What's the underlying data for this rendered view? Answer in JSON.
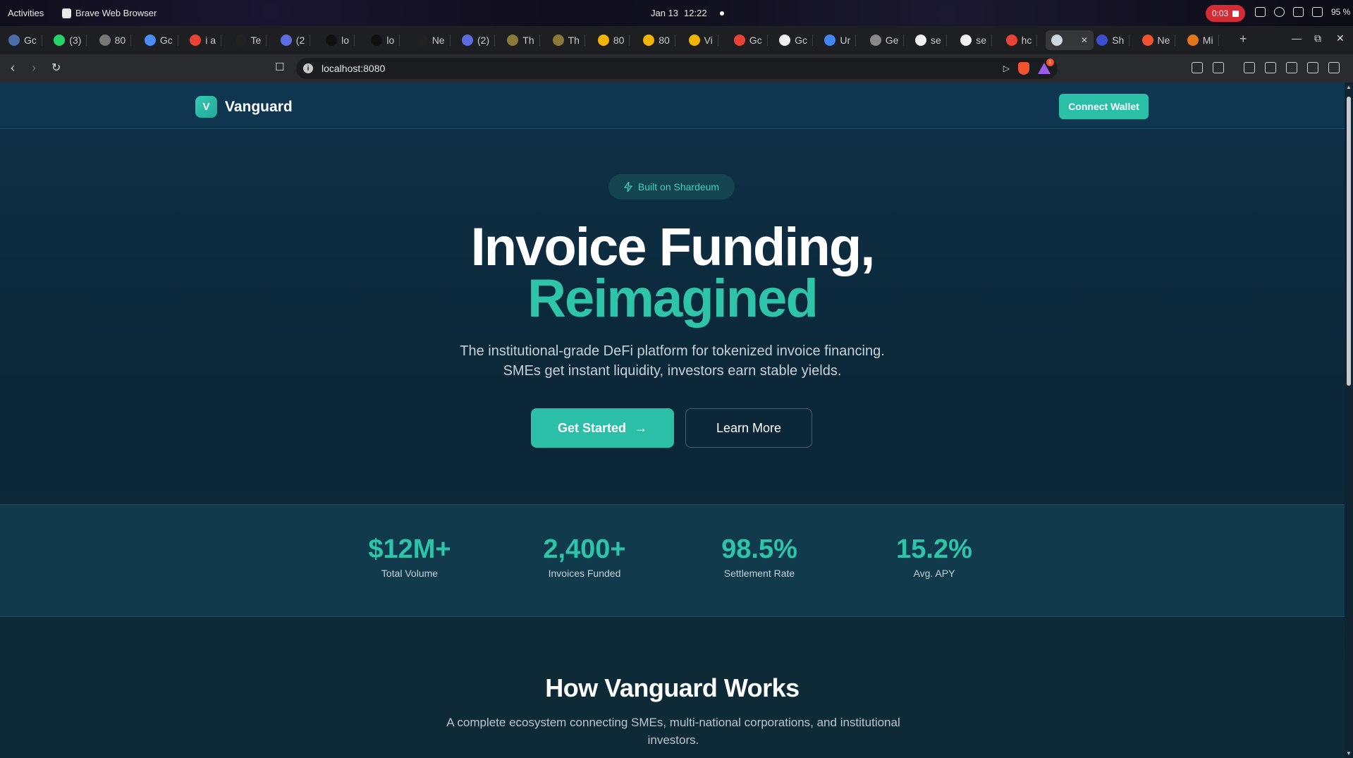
{
  "os_bar": {
    "activities": "Activities",
    "app_name": "Brave Web Browser",
    "date": "Jan 13",
    "time": "12:22",
    "recording_time": "0:03",
    "battery": "95 %"
  },
  "browser": {
    "tabs": [
      {
        "label": "Gc",
        "icon": "globe-icon",
        "color": "#4a6da7"
      },
      {
        "label": "(3)",
        "icon": "whatsapp-icon",
        "color": "#25d366"
      },
      {
        "label": "80",
        "icon": "globe-icon",
        "color": "#777"
      },
      {
        "label": "Gc",
        "icon": "gemini-icon",
        "color": "#4b8df8"
      },
      {
        "label": "i a",
        "icon": "google-icon",
        "color": "#ea4335"
      },
      {
        "label": "Te",
        "icon": "triangle-icon",
        "color": "#222"
      },
      {
        "label": "(2",
        "icon": "chrome-icon",
        "color": "#5b6ee1"
      },
      {
        "label": "lo",
        "icon": "vercel-icon",
        "color": "#111"
      },
      {
        "label": "lo",
        "icon": "vercel-icon",
        "color": "#111"
      },
      {
        "label": "Ne",
        "icon": "triangle-icon",
        "color": "#222"
      },
      {
        "label": "(2)",
        "icon": "chrome-icon",
        "color": "#5b6ee1"
      },
      {
        "label": "Th",
        "icon": "coin-icon",
        "color": "#8a7a3a"
      },
      {
        "label": "Th",
        "icon": "coin-icon",
        "color": "#8a7a3a"
      },
      {
        "label": "80",
        "icon": "v-icon",
        "color": "#f5b400"
      },
      {
        "label": "80",
        "icon": "v-icon",
        "color": "#f5b400"
      },
      {
        "label": "Vi",
        "icon": "v-icon",
        "color": "#f5b400"
      },
      {
        "label": "Gc",
        "icon": "gmail-icon",
        "color": "#ea4335"
      },
      {
        "label": "Gc",
        "icon": "github-icon",
        "color": "#f0f0f0"
      },
      {
        "label": "Ur",
        "icon": "docs-icon",
        "color": "#4285f4"
      },
      {
        "label": "Ge",
        "icon": "openai-icon",
        "color": "#888"
      },
      {
        "label": "se",
        "icon": "github-icon",
        "color": "#f0f0f0"
      },
      {
        "label": "se",
        "icon": "github-icon",
        "color": "#f0f0f0"
      },
      {
        "label": "hc",
        "icon": "google-icon",
        "color": "#ea4335"
      },
      {
        "label": "",
        "icon": "vanguard-icon",
        "color": "#cfd8e0",
        "active": true
      },
      {
        "label": "Sh",
        "icon": "shardeum-icon",
        "color": "#3b4fd1"
      },
      {
        "label": "Ne",
        "icon": "brave-icon",
        "color": "#f0532d"
      },
      {
        "label": "Mi",
        "icon": "metamask-icon",
        "color": "#e2761b"
      }
    ],
    "url": "localhost:8080",
    "shields_count": "1"
  },
  "site": {
    "logo_letter": "V",
    "brand": "Vanguard",
    "connect_wallet": "Connect Wallet",
    "badge": "Built on Shardeum",
    "hero_line1": "Invoice Funding,",
    "hero_line2": "Reimagined",
    "hero_sub1": "The institutional-grade DeFi platform for tokenized invoice financing.",
    "hero_sub2": "SMEs get instant liquidity, investors earn stable yields.",
    "cta_primary": "Get Started",
    "cta_secondary": "Learn More",
    "stats": [
      {
        "value": "$12M+",
        "label": "Total Volume"
      },
      {
        "value": "2,400+",
        "label": "Invoices Funded"
      },
      {
        "value": "98.5%",
        "label": "Settlement Rate"
      },
      {
        "value": "15.2%",
        "label": "Avg. APY"
      }
    ],
    "how_title": "How Vanguard Works",
    "how_sub": "A complete ecosystem connecting SMEs, multi-national corporations, and institutional investors."
  },
  "colors": {
    "accent": "#2ec4aa",
    "page_bg": "#0e3048",
    "recording": "#d42b34"
  }
}
